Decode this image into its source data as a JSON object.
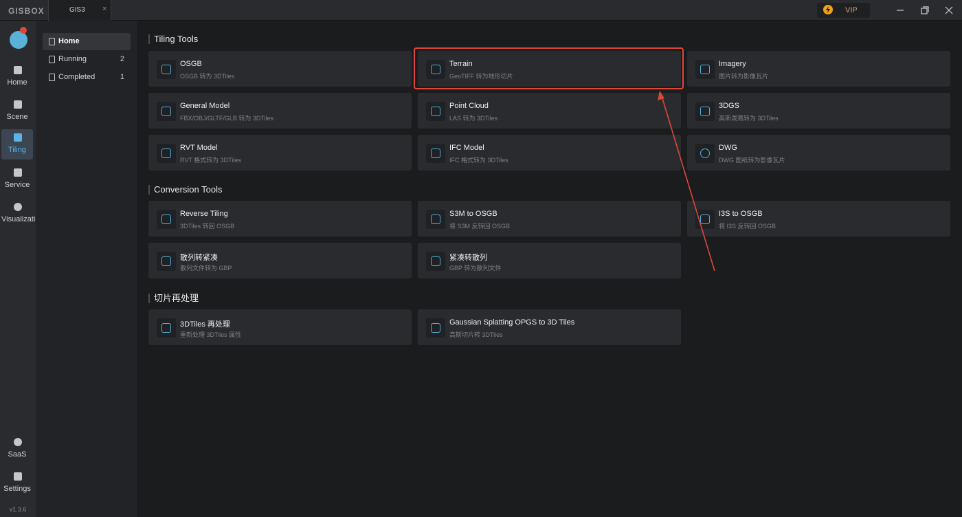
{
  "titlebar": {
    "logo": "GISBOX",
    "tab_label": "GIS3",
    "tab_close": "×",
    "vip_label": "VIP"
  },
  "sidebar": {
    "items": [
      {
        "label": "Home",
        "icon": "home-icon"
      },
      {
        "label": "Scene",
        "icon": "cube-icon"
      },
      {
        "label": "Tiling",
        "icon": "tiling-icon",
        "active": true
      },
      {
        "label": "Service",
        "icon": "service-icon"
      },
      {
        "label": "Visualization",
        "icon": "visualization-icon"
      },
      {
        "label": "SaaS",
        "icon": "lock-icon"
      },
      {
        "label": "Settings",
        "icon": "gear-icon"
      }
    ],
    "version": "v1.3.6"
  },
  "subnav": {
    "items": [
      {
        "label": "Home",
        "count": ""
      },
      {
        "label": "Running",
        "count": "2"
      },
      {
        "label": "Completed",
        "count": "1"
      }
    ]
  },
  "sections": [
    {
      "title": "Tiling Tools",
      "cards": [
        {
          "title": "OSGB",
          "subtitle": "OSGB 转为 3DTiles"
        },
        {
          "title": "Terrain",
          "subtitle": "GeoTIFF 转为地形切片"
        },
        {
          "title": "Imagery",
          "subtitle": "图片转为影像瓦片"
        },
        {
          "title": "General Model",
          "subtitle": "FBX/OBJ/GLTF/GLB 转为 3DTiles"
        },
        {
          "title": "Point Cloud",
          "subtitle": "LAS 转为 3DTiles"
        },
        {
          "title": "3DGS",
          "subtitle": "高斯泼溅转为 3DTiles"
        },
        {
          "title": "RVT Model",
          "subtitle": "RVT 格式转为 3DTiles"
        },
        {
          "title": "IFC Model",
          "subtitle": "IFC 格式转为 3DTiles"
        },
        {
          "title": "DWG",
          "subtitle": "DWG 图纸转为影像瓦片"
        }
      ]
    },
    {
      "title": "Conversion Tools",
      "cards": [
        {
          "title": "Reverse Tiling",
          "subtitle": "3DTiles 转回 OSGB"
        },
        {
          "title": "S3M to OSGB",
          "subtitle": "将 S3M 反转回 OSGB"
        },
        {
          "title": "I3S to OSGB",
          "subtitle": "将 I3S 反转回 OSGB"
        },
        {
          "title": "散列转紧凑",
          "subtitle": "散列文件转为 GBP"
        },
        {
          "title": "紧凑转散列",
          "subtitle": "GBP 转为散列文件"
        }
      ]
    },
    {
      "title": "切片再处理",
      "cards": [
        {
          "title": "3DTiles 再处理",
          "subtitle": "重新处理 3DTiles 属性"
        },
        {
          "title": "Gaussian Splatting OPGS to 3D Tiles",
          "subtitle": "高斯切片转 3DTiles"
        }
      ]
    }
  ],
  "colors": {
    "accent": "#5ab5e6",
    "highlight": "#e0463a",
    "vip": "#f2a11a"
  }
}
